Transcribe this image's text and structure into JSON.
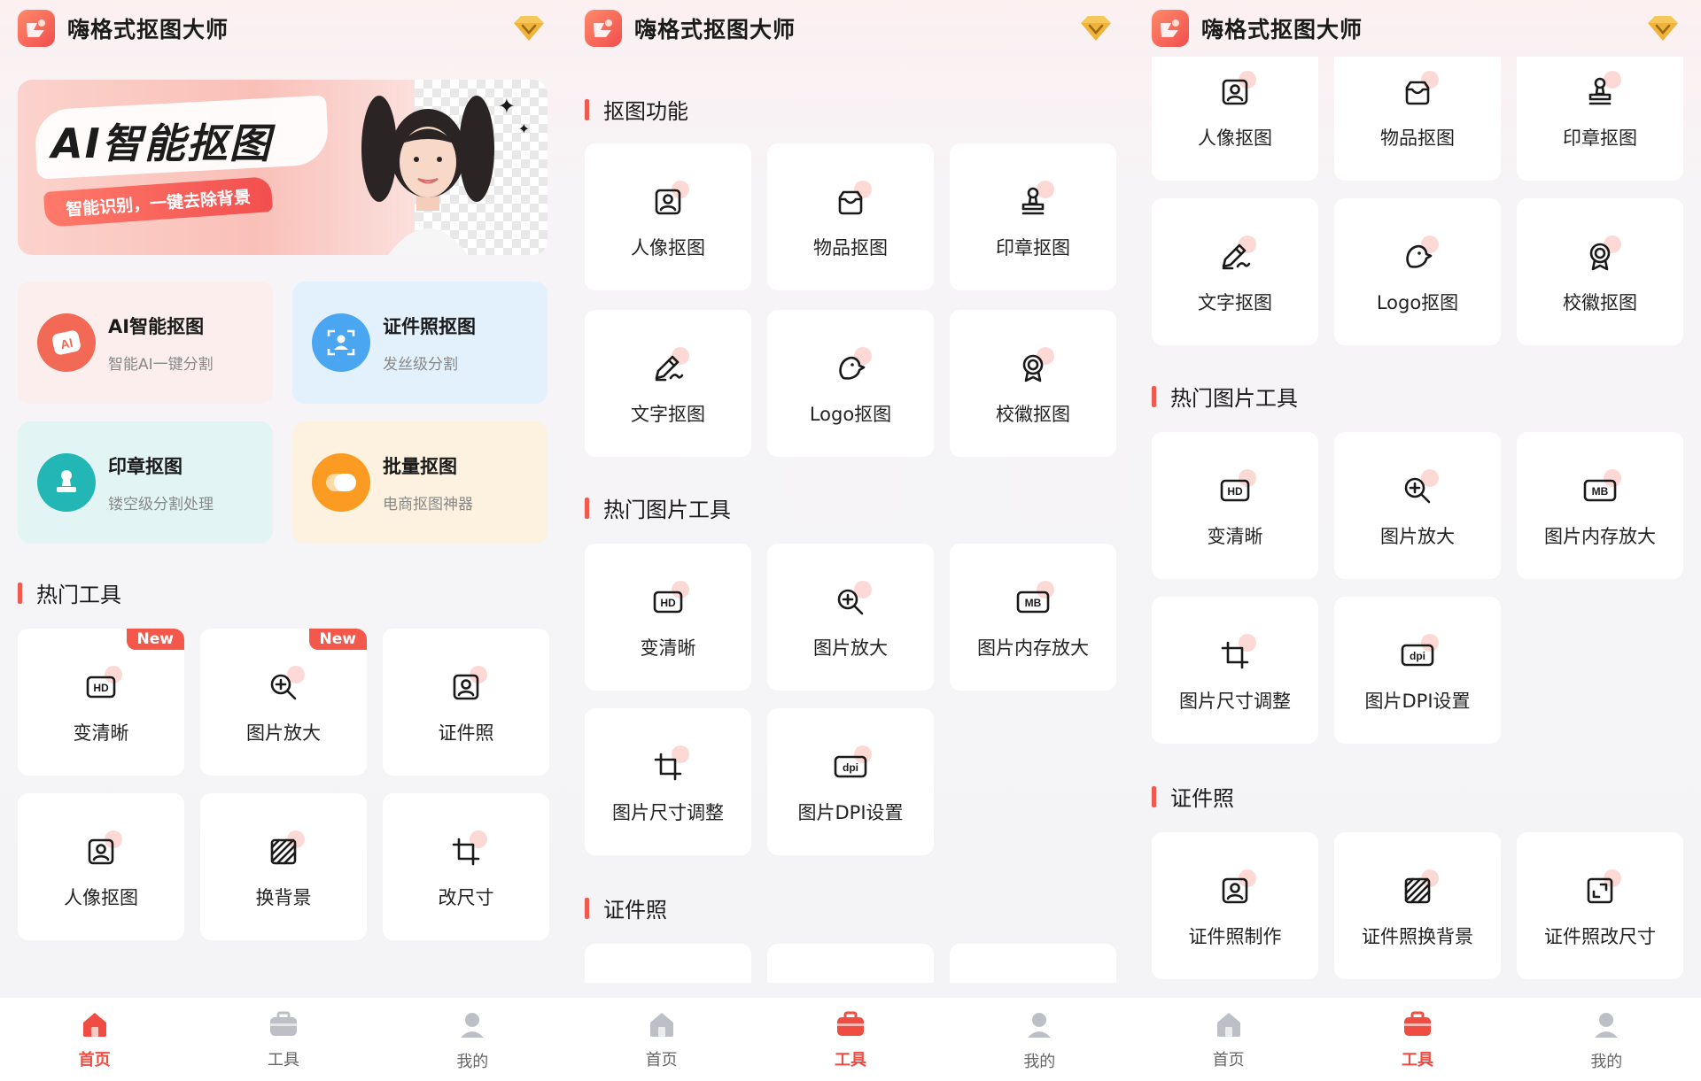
{
  "app": {
    "title": "嗨格式抠图大师"
  },
  "home": {
    "banner": {
      "headline": "AI智能抠图",
      "tagline": "智能识别，一键去除背景"
    },
    "features": [
      {
        "title": "AI智能抠图",
        "subtitle": "智能AI一键分割",
        "icon": "ai-icon",
        "color": "#f26a55"
      },
      {
        "title": "证件照抠图",
        "subtitle": "发丝级分割",
        "icon": "id-person-icon",
        "color": "#4aa6f0"
      },
      {
        "title": "印章抠图",
        "subtitle": "镂空级分割处理",
        "icon": "stamp-icon",
        "color": "#22b7b4"
      },
      {
        "title": "批量抠图",
        "subtitle": "电商抠图神器",
        "icon": "batch-icon",
        "color": "#fb9b22"
      }
    ],
    "hot_section": "热门工具",
    "hot_tools": [
      {
        "label": "变清晰",
        "icon": "hd-icon",
        "badge": "New"
      },
      {
        "label": "图片放大",
        "icon": "zoom-in-icon",
        "badge": "New"
      },
      {
        "label": "证件照",
        "icon": "id-photo-icon",
        "badge": ""
      },
      {
        "label": "人像抠图",
        "icon": "portrait-icon",
        "badge": ""
      },
      {
        "label": "换背景",
        "icon": "background-icon",
        "badge": ""
      },
      {
        "label": "改尺寸",
        "icon": "crop-icon",
        "badge": ""
      }
    ]
  },
  "tools": {
    "cutout_section": "抠图功能",
    "cutout_tools": [
      {
        "label": "人像抠图",
        "icon": "portrait-icon"
      },
      {
        "label": "物品抠图",
        "icon": "item-icon"
      },
      {
        "label": "印章抠图",
        "icon": "stamp-icon"
      },
      {
        "label": "文字抠图",
        "icon": "text-pen-icon"
      },
      {
        "label": "Logo抠图",
        "icon": "logo-bird-icon"
      },
      {
        "label": "校徽抠图",
        "icon": "badge-icon"
      }
    ],
    "hot_section": "热门图片工具",
    "image_tools": [
      {
        "label": "变清晰",
        "icon": "hd-icon"
      },
      {
        "label": "图片放大",
        "icon": "zoom-in-icon"
      },
      {
        "label": "图片内存放大",
        "icon": "mb-icon"
      },
      {
        "label": "图片尺寸调整",
        "icon": "crop-icon"
      },
      {
        "label": "图片DPI设置",
        "icon": "dpi-icon"
      }
    ],
    "id_section": "证件照",
    "id_tools": [
      {
        "label": "证件照制作",
        "icon": "portrait-icon"
      },
      {
        "label": "证件照换背景",
        "icon": "background-icon"
      },
      {
        "label": "证件照改尺寸",
        "icon": "resize-icon"
      }
    ]
  },
  "tabbar": [
    {
      "label": "首页",
      "icon": "home-icon"
    },
    {
      "label": "工具",
      "icon": "toolbox-icon"
    },
    {
      "label": "我的",
      "icon": "profile-icon"
    }
  ],
  "colors": {
    "accent": "#ef4c42",
    "section_bar": "#f05a4f",
    "new_badge": "#f4584b"
  }
}
